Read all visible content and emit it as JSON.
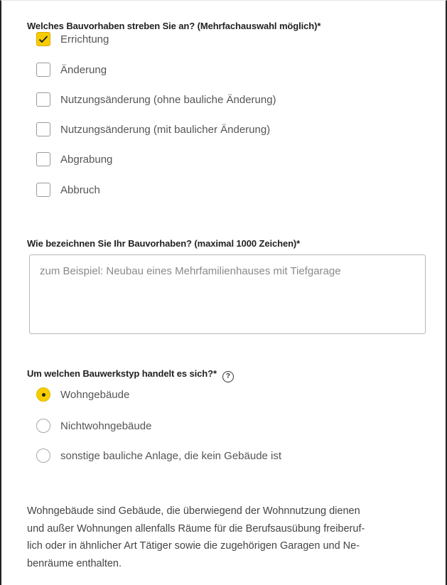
{
  "section1": {
    "label": "Welches Bauvorhaben streben Sie an? (Mehrfachauswahl möglich)*",
    "options": [
      {
        "label": "Errichtung",
        "checked": true
      },
      {
        "label": "Änderung",
        "checked": false
      },
      {
        "label": "Nutzungsänderung (ohne bauliche Änderung)",
        "checked": false
      },
      {
        "label": "Nutzungsänderung (mit baulicher Änderung)",
        "checked": false
      },
      {
        "label": "Abgrabung",
        "checked": false
      },
      {
        "label": "Abbruch",
        "checked": false
      }
    ]
  },
  "section2": {
    "label": "Wie bezeichnen Sie Ihr Bauvorhaben? (maximal 1000 Zeichen)*",
    "placeholder": "zum Beispiel: Neubau eines Mehrfamilienhauses mit Tiefgarage",
    "value": ""
  },
  "section3": {
    "label": "Um welchen Bauwerkstyp handelt es sich?*",
    "help_icon": "?",
    "options": [
      {
        "label": "Wohngebäude",
        "selected": true
      },
      {
        "label": "Nichtwohngebäude",
        "selected": false
      },
      {
        "label": "sonstige bauliche Anlage, die kein Gebäude ist",
        "selected": false
      }
    ]
  },
  "info_text": [
    "Wohngebäude sind Gebäude, die überwiegend der Wohnnutzung dienen",
    "und außer Wohnungen allenfalls Räume für die Berufsausübung freiberuf-",
    "lich oder in ähnlicher Art Tätiger sowie die zugehörigen Garagen und Ne-",
    "benräume enthalten."
  ],
  "colors": {
    "accent": "#f7cd00",
    "text": "#333333",
    "border": "#9a9a9a"
  }
}
